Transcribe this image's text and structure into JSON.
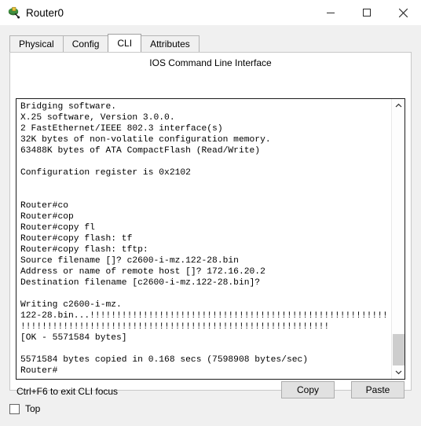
{
  "window": {
    "title": "Router0",
    "icon": "router-device-icon",
    "controls": {
      "minimize": "minimize-icon",
      "maximize": "maximize-icon",
      "close": "close-icon"
    }
  },
  "tabs": [
    {
      "label": "Physical",
      "active": false
    },
    {
      "label": "Config",
      "active": false
    },
    {
      "label": "CLI",
      "active": true
    },
    {
      "label": "Attributes",
      "active": false
    }
  ],
  "pane": {
    "heading": "IOS Command Line Interface"
  },
  "terminal": {
    "lines": [
      "Bridging software.",
      "X.25 software, Version 3.0.0.",
      "2 FastEthernet/IEEE 802.3 interface(s)",
      "32K bytes of non-volatile configuration memory.",
      "63488K bytes of ATA CompactFlash (Read/Write)",
      "",
      "Configuration register is 0x2102",
      "",
      "",
      "Router#co",
      "Router#cop",
      "Router#copy fl",
      "Router#copy flash: tf",
      "Router#copy flash: tftp:",
      "Source filename []? c2600-i-mz.122-28.bin",
      "Address or name of remote host []? 172.16.20.2",
      "Destination filename [c2600-i-mz.122-28.bin]?",
      "",
      "Writing c2600-i-mz.",
      "122-28.bin...!!!!!!!!!!!!!!!!!!!!!!!!!!!!!!!!!!!!!!!!!!!!!!!!!!!!!!!!",
      "!!!!!!!!!!!!!!!!!!!!!!!!!!!!!!!!!!!!!!!!!!!!!!!!!!!!!!!!!!",
      "[OK - 5571584 bytes]",
      "",
      "5571584 bytes copied in 0.168 secs (7598908 bytes/sec)",
      "Router#"
    ],
    "scrollbar": {
      "up_arrow": "chevron-up-icon",
      "down_arrow": "chevron-down-icon"
    }
  },
  "footer": {
    "hint": "Ctrl+F6 to exit CLI focus",
    "copy_label": "Copy",
    "paste_label": "Paste"
  },
  "top_option": {
    "label": "Top",
    "checked": false
  }
}
